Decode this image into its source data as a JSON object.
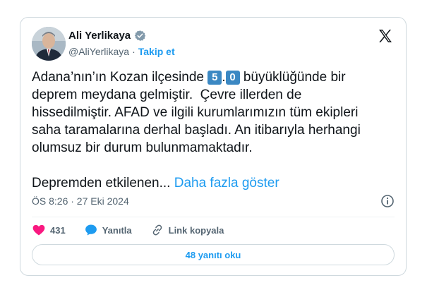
{
  "author": {
    "name": "Ali Yerlikaya",
    "handle": "@AliYerlikaya",
    "separator": "·",
    "follow_label": "Takip et"
  },
  "tweet": {
    "line1_pre": "Adana’nın’ın Kozan ilçesinde ",
    "digit1": "5",
    "digit_dot": ".",
    "digit2": "0",
    "line1_post": " büyüklüğünde bir",
    "line2": "deprem meydana gelmiştir.  Çevre illerden de",
    "line3": "hissedilmiştir. AFAD ve ilgili kurumlarımızın tüm ekipleri",
    "line4": "saha taramalarına derhal başladı. An itibarıyla herhangi",
    "line5": "olumsuz bir durum bulunmamaktadır.",
    "line6": "Depremden etkilenen...",
    "show_more": "Daha fazla göster"
  },
  "timestamp": "ÖS 8:26 · 27 Eki 2024",
  "actions": {
    "like_count": "431",
    "reply_label": "Yanıtla",
    "copy_link_label": "Link kopyala"
  },
  "read_replies_label": "48 yanıtı oku",
  "colors": {
    "accent": "#1d9bf0",
    "like": "#f91880",
    "emoji_box": "#3b88c3"
  },
  "icons": [
    "verified-badge-icon",
    "x-logo-icon",
    "info-icon",
    "heart-icon",
    "reply-bubble-icon",
    "link-icon"
  ]
}
